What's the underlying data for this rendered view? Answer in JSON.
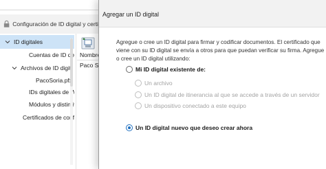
{
  "background_window": {
    "title": "Configuración de ID digital y certificados",
    "tree": [
      "ID digitales",
      "Cuentas de ID de iti",
      "Archivos de ID digit",
      "PacoSoria.pfx",
      "IDs digitales de Win",
      "Módulos y distintivo",
      "Certificados de confian"
    ],
    "column_header": "Nombre",
    "row_1": "Paco Soria"
  },
  "dialog": {
    "title": "Agregar un ID digital",
    "description": "Agregue o cree un ID digital para firmar y codificar documentos. El certificado que viene con su ID digital se envía a otros para que puedan verificar su firma. Agregue o cree un ID digital utilizando:",
    "option_existing": "Mi ID digital existente de:",
    "sub_option_file": "Un archivo",
    "sub_option_roaming": "Un ID digital de itinerancia al que se accede a través de un servidor",
    "sub_option_device": "Un dispositivo conectado a este equipo",
    "option_new": "Un ID digital nuevo que deseo crear ahora"
  },
  "colors": {
    "selection": "#cde3f7",
    "radio_accent": "#1f6fbf",
    "disabled_text": "#a3a3a3"
  }
}
